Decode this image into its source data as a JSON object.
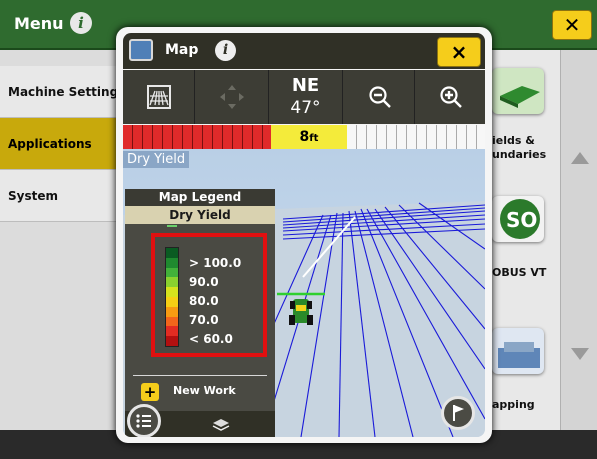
{
  "menu": {
    "title": "Menu",
    "info_icon": "info-icon",
    "close_icon": "close-icon",
    "sidebar_items": [
      {
        "label": "Machine Settings",
        "active": false
      },
      {
        "label": "Applications",
        "active": true
      },
      {
        "label": "System",
        "active": false
      }
    ],
    "tiles": [
      {
        "label": "ields &",
        "label2": "undaries",
        "icon": "fields-boundaries-icon"
      },
      {
        "label": "OBUS VT",
        "icon": "isobus-vt-icon"
      },
      {
        "label": "apping",
        "icon": "mapping-icon"
      }
    ],
    "scroll_up_icon": "scroll-up-icon",
    "scroll_down_icon": "scroll-down-icon"
  },
  "map_window": {
    "title": "Map",
    "info_icon": "info-icon",
    "close_label": "×",
    "toolbar": {
      "view_toggle_icon": "grid-view-icon",
      "pan_icon": "pan-arrows-icon",
      "heading_label": "NE",
      "heading_degrees": "47°",
      "zoom_out_icon": "zoom-out-icon",
      "zoom_in_icon": "zoom-in-icon"
    },
    "width_strip": {
      "value": "8",
      "unit": "ft"
    },
    "layer_label": "Dry Yield",
    "legend": {
      "title": "Map Legend",
      "subtitle": "Dry Yield",
      "levels": [
        "> 100.0",
        "90.0",
        "80.0",
        "70.0",
        "< 60.0"
      ],
      "colors": [
        "#0a5b22",
        "#1f8a2f",
        "#42b13a",
        "#8ad12f",
        "#d6e21d",
        "#f6cf14",
        "#f79b12",
        "#f2651b",
        "#e22c22",
        "#b31010"
      ],
      "new_work_label": "New Work",
      "new_work_icon": "plus-icon",
      "list_icon": "list-icon",
      "layers_icon": "layers-icon"
    },
    "flag_icon": "flag-icon"
  }
}
